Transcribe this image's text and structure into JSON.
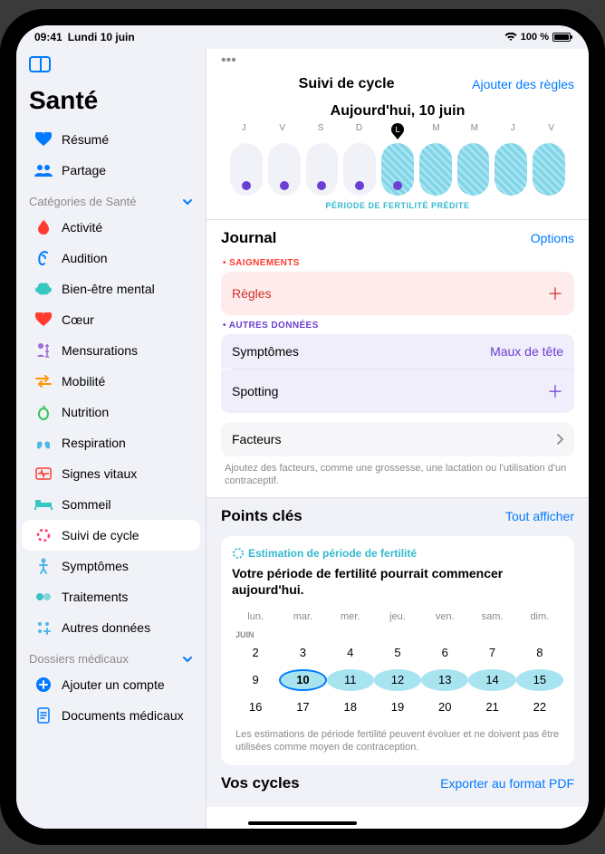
{
  "status": {
    "time": "09:41",
    "date": "Lundi 10 juin",
    "battery": "100 %"
  },
  "sidebar": {
    "title": "Santé",
    "resume": "Résumé",
    "partage": "Partage",
    "categories_label": "Catégories de Santé",
    "items": [
      {
        "label": "Activité",
        "icon": "flame",
        "color": "#ff3b30"
      },
      {
        "label": "Audition",
        "icon": "ear",
        "color": "#007aff"
      },
      {
        "label": "Bien-être mental",
        "icon": "brain",
        "color": "#35c7c0"
      },
      {
        "label": "Cœur",
        "icon": "heart",
        "color": "#ff3b30"
      },
      {
        "label": "Mensurations",
        "icon": "ruler",
        "color": "#a06bd4"
      },
      {
        "label": "Mobilité",
        "icon": "arrows",
        "color": "#ff9500"
      },
      {
        "label": "Nutrition",
        "icon": "apple",
        "color": "#34c759"
      },
      {
        "label": "Respiration",
        "icon": "lungs",
        "color": "#4fb8e8"
      },
      {
        "label": "Signes vitaux",
        "icon": "vitals",
        "color": "#ff3b30"
      },
      {
        "label": "Sommeil",
        "icon": "bed",
        "color": "#35c7c0"
      },
      {
        "label": "Suivi de cycle",
        "icon": "cycle",
        "color": "#ff3b6b"
      },
      {
        "label": "Symptômes",
        "icon": "person",
        "color": "#4fb8e8"
      },
      {
        "label": "Traitements",
        "icon": "pills",
        "color": "#3fc0c8"
      },
      {
        "label": "Autres données",
        "icon": "plus-grid",
        "color": "#4fb8e8"
      }
    ],
    "dossiers_label": "Dossiers médicaux",
    "ajouter_compte": "Ajouter un compte",
    "documents": "Documents médicaux"
  },
  "main": {
    "nav_title": "Suivi de cycle",
    "nav_action": "Ajouter des règles",
    "today": "Aujourd'hui, 10 juin",
    "weekdays": [
      "J",
      "V",
      "S",
      "D",
      "L",
      "M",
      "M",
      "J",
      "V"
    ],
    "fertile_label": "PÉRIODE DE FERTILITÉ PRÉDITE",
    "journal": {
      "title": "Journal",
      "options": "Options",
      "bleed_label": "SAIGNEMENTS",
      "regles": "Règles",
      "other_label": "AUTRES DONNÉES",
      "symptomes": "Symptômes",
      "symptomes_val": "Maux de tête",
      "spotting": "Spotting",
      "facteurs": "Facteurs",
      "facteurs_hint": "Ajoutez des facteurs, comme une grossesse, une lactation ou l'utilisation d'un contraceptif."
    },
    "points": {
      "title": "Points clés",
      "show_all": "Tout afficher",
      "estim_label": "Estimation de période de fertilité",
      "estim_text": "Votre période de fertilité pourrait commencer aujourd'hui.",
      "weekdays": [
        "lun.",
        "mar.",
        "mer.",
        "jeu.",
        "ven.",
        "sam.",
        "dim."
      ],
      "month": "JUIN",
      "rows": [
        [
          {
            "d": 2
          },
          {
            "d": 3
          },
          {
            "d": 4
          },
          {
            "d": 5
          },
          {
            "d": 6
          },
          {
            "d": 7
          },
          {
            "d": 8
          }
        ],
        [
          {
            "d": 9
          },
          {
            "d": 10,
            "today": true,
            "f": true
          },
          {
            "d": 11,
            "f": true
          },
          {
            "d": 12,
            "f": true
          },
          {
            "d": 13,
            "f": true
          },
          {
            "d": 14,
            "f": true
          },
          {
            "d": 15,
            "f": true
          }
        ],
        [
          {
            "d": 16
          },
          {
            "d": 17
          },
          {
            "d": 18
          },
          {
            "d": 19
          },
          {
            "d": 20
          },
          {
            "d": 21
          },
          {
            "d": 22
          }
        ]
      ],
      "disclaimer": "Les estimations de période fertilité peuvent évoluer et ne doivent pas être utilisées comme moyen de contraception."
    },
    "cycles": {
      "title": "Vos cycles",
      "export": "Exporter au format PDF"
    }
  }
}
